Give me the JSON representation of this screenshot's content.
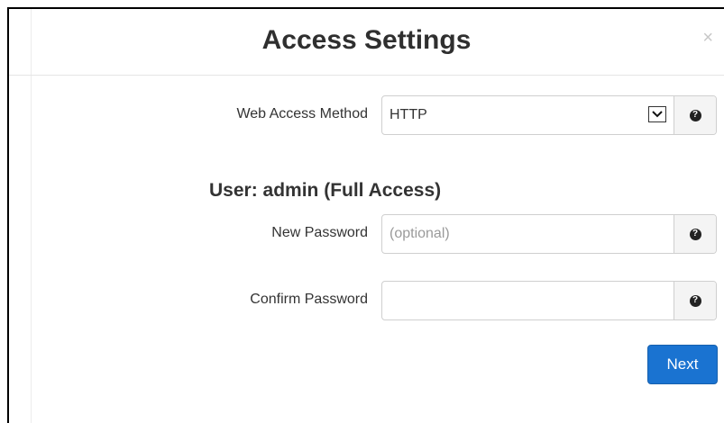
{
  "dialog": {
    "title": "Access Settings",
    "close_label": "×"
  },
  "web_access": {
    "label": "Web Access Method",
    "selected_value": "HTTP",
    "help_icon": "question-circle"
  },
  "user_section": {
    "title": "User: admin (Full Access)"
  },
  "new_password": {
    "label": "New Password",
    "placeholder": "(optional)",
    "value": "",
    "help_icon": "question-circle"
  },
  "confirm_password": {
    "label": "Confirm Password",
    "placeholder": "",
    "value": "",
    "help_icon": "question-circle"
  },
  "actions": {
    "next_label": "Next"
  },
  "colors": {
    "primary": "#1a73d1",
    "text": "#333333"
  }
}
